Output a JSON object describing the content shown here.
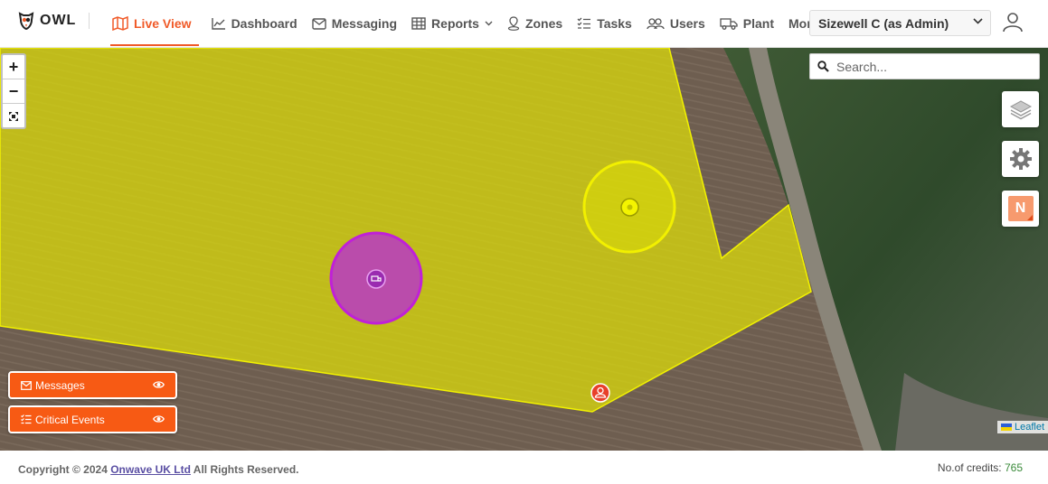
{
  "app": {
    "brand": "OWL"
  },
  "nav": {
    "items": [
      {
        "label": "Live View",
        "icon": "map-icon",
        "active": true
      },
      {
        "label": "Dashboard",
        "icon": "chart-icon"
      },
      {
        "label": "Messaging",
        "icon": "envelope-icon"
      },
      {
        "label": "Reports",
        "icon": "table-icon",
        "has_dropdown": true
      },
      {
        "label": "Zones",
        "icon": "location-pin-icon"
      },
      {
        "label": "Tasks",
        "icon": "checklist-icon"
      },
      {
        "label": "Users",
        "icon": "users-icon"
      },
      {
        "label": "Plant",
        "icon": "truck-icon"
      },
      {
        "label": "More",
        "has_dropdown": true
      }
    ],
    "site_select": {
      "value": "Sizewell C (as Admin)"
    }
  },
  "map": {
    "zoom_in": "+",
    "zoom_out": "−",
    "search_placeholder": "Search...",
    "layers_icon": "layers-icon",
    "settings_icon": "gear-icon",
    "app_badge": "N",
    "attribution": "Leaflet",
    "panels": [
      {
        "label": "Messages",
        "icon": "envelope-icon"
      },
      {
        "label": "Critical Events",
        "icon": "checklist-icon"
      }
    ],
    "colors": {
      "zone_fill": "#d7d60d",
      "zone_stroke": "#f2f200",
      "purple_zone": "#c020d8",
      "yellow_zone": "#f2f000",
      "accent": "#f75a14"
    }
  },
  "footer": {
    "copyright_prefix": "Copyright © 2024",
    "company": "Onwave UK Ltd",
    "copyright_suffix": "All Rights Reserved.",
    "credits_label": "No.of credits:",
    "credits_value": "765"
  }
}
